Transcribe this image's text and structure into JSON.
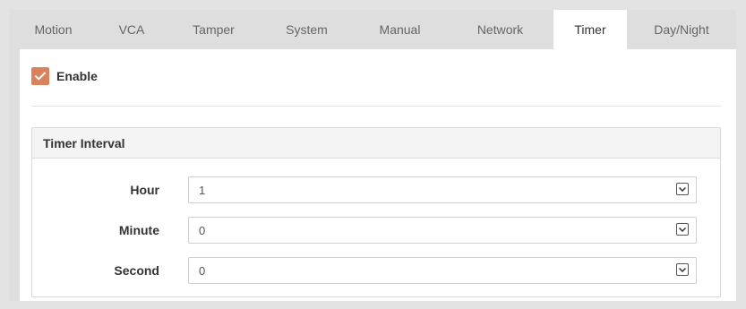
{
  "tabs": [
    {
      "label": "Motion"
    },
    {
      "label": "VCA"
    },
    {
      "label": "Tamper"
    },
    {
      "label": "System"
    },
    {
      "label": "Manual"
    },
    {
      "label": "Network"
    },
    {
      "label": "Timer"
    },
    {
      "label": "Day/Night"
    }
  ],
  "active_tab": "Timer",
  "enable": {
    "label": "Enable",
    "checked": true
  },
  "timer_interval": {
    "title": "Timer Interval",
    "fields": [
      {
        "label": "Hour",
        "value": "1"
      },
      {
        "label": "Minute",
        "value": "0"
      },
      {
        "label": "Second",
        "value": "0"
      }
    ]
  },
  "colors": {
    "accent": "#d9825b",
    "page_bg": "#e3e3e3",
    "panel_bg": "#ffffff",
    "header_bg": "#f4f4f4"
  },
  "icons": {
    "checkbox": "checkmark-icon",
    "select_arrow": "chevron-down-icon"
  }
}
